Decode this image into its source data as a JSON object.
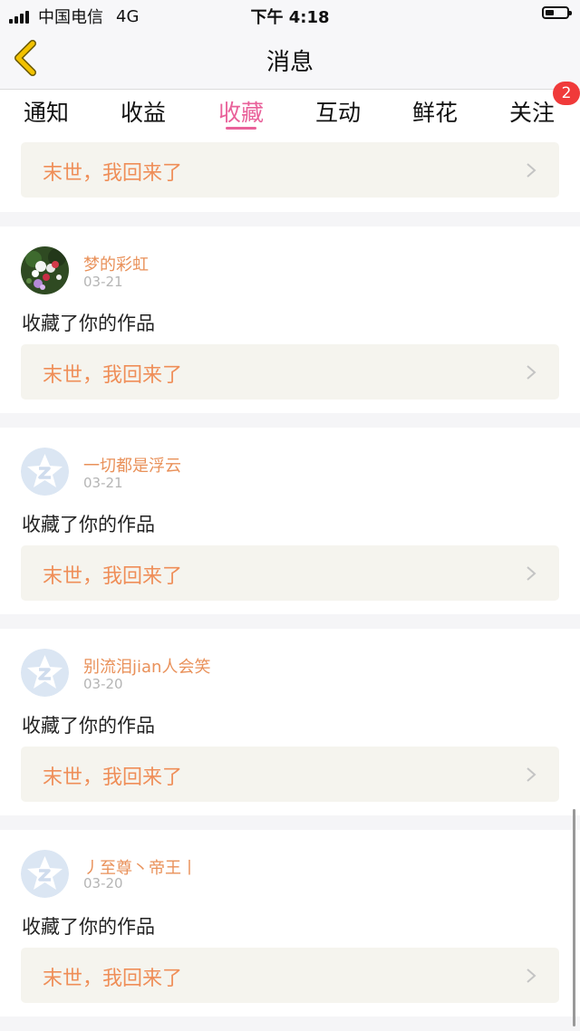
{
  "status_bar": {
    "carrier": "中国电信",
    "network": "4G",
    "time": "下午 4:18",
    "battery_level": 0.3
  },
  "nav": {
    "title": "消息",
    "back_icon": "chevron-left-icon",
    "back_color": "#f2c200"
  },
  "tabs": [
    {
      "label": "通知"
    },
    {
      "label": "收益"
    },
    {
      "label": "收藏",
      "active": true
    },
    {
      "label": "互动"
    },
    {
      "label": "鲜花"
    },
    {
      "label": "关注",
      "badge": "2"
    }
  ],
  "colors": {
    "accent": "#e9619a",
    "username": "#e9915a",
    "work_title": "#ef8e58",
    "badge": "#f03a3a"
  },
  "partial_item": {
    "work_title": "末世，我回来了"
  },
  "items": [
    {
      "username": "梦的彩虹",
      "date": "03-21",
      "action": "收藏了你的作品",
      "work_title": "末世，我回来了",
      "avatar": "flower-photo-avatar"
    },
    {
      "username": "一切都是浮云",
      "date": "03-21",
      "action": "收藏了你的作品",
      "work_title": "末世，我回来了",
      "avatar": "default-star-avatar"
    },
    {
      "username": "别流泪jian人会笑",
      "date": "03-20",
      "action": "收藏了你的作品",
      "work_title": "末世，我回来了",
      "avatar": "default-star-avatar"
    },
    {
      "username": "丿至尊丶帝王丨",
      "date": "03-20",
      "action": "收藏了你的作品",
      "work_title": "末世，我回来了",
      "avatar": "default-star-avatar"
    }
  ]
}
